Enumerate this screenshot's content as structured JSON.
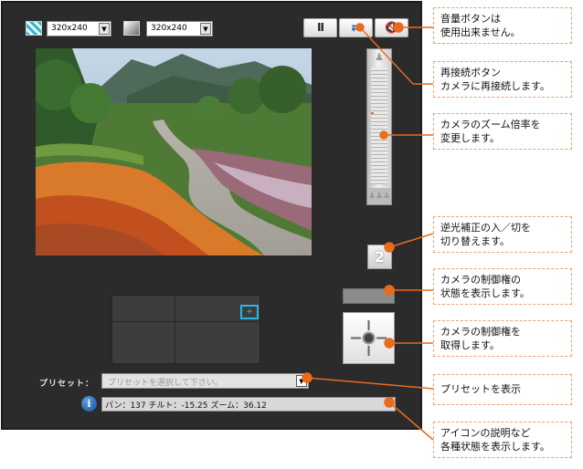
{
  "toolbar": {
    "color_size": "320x240",
    "gray_size": "320x240",
    "pause_label": "II",
    "reconnect_label": "⇄",
    "volume_label": "🔇"
  },
  "zoom": {
    "top_label": "♟",
    "bottom_label": "♟♟♟",
    "level": 0.38
  },
  "backlight": {
    "label": "2"
  },
  "ptz_pad": {
    "cursor_label": "+"
  },
  "preset": {
    "label": "プリセット：",
    "placeholder": "プリセットを選択して下さい。"
  },
  "status": {
    "info_icon_label": "i",
    "text": "パン：137 チルト：-15.25 ズーム：36.12"
  },
  "callouts": [
    {
      "lines": [
        "音量ボタンは",
        "使用出来ません。"
      ]
    },
    {
      "lines": [
        "再接続ボタン",
        "カメラに再接続します。"
      ]
    },
    {
      "lines": [
        "カメラのズーム倍率を",
        "変更します。"
      ]
    },
    {
      "lines": [
        "逆光補正の入／切を",
        "切り替えます。"
      ]
    },
    {
      "lines": [
        "カメラの制御権の",
        "状態を表示します。"
      ]
    },
    {
      "lines": [
        "カメラの制御権を",
        "取得します。"
      ]
    },
    {
      "lines": [
        "プリセットを表示"
      ]
    },
    {
      "lines": [
        "アイコンの説明など",
        "各種状態を表示します。"
      ]
    }
  ],
  "colors": {
    "panel_bg": "#2b2b2b",
    "accent_line": "#e96b1c",
    "callout_border": "#f0a070",
    "highlight_cyan": "#29b6e6"
  }
}
